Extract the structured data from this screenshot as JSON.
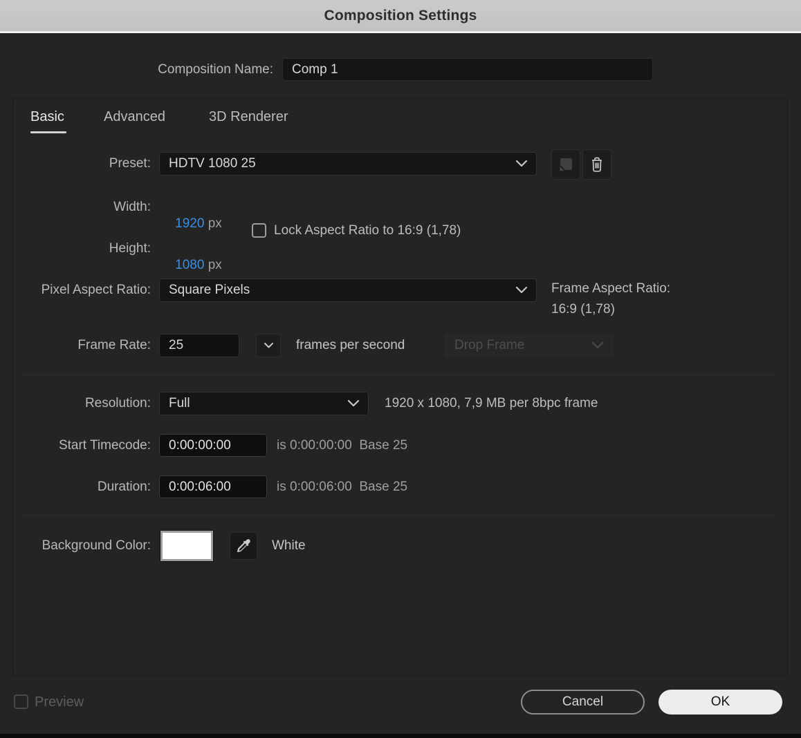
{
  "titlebar": {
    "title": "Composition Settings"
  },
  "composition_name": {
    "label": "Composition Name:",
    "value": "Comp 1"
  },
  "tabs": [
    {
      "label": "Basic",
      "active": true
    },
    {
      "label": "Advanced",
      "active": false
    },
    {
      "label": "3D Renderer",
      "active": false
    }
  ],
  "basic": {
    "preset": {
      "label": "Preset:",
      "value": "HDTV 1080 25"
    },
    "width": {
      "label": "Width:",
      "value": "1920",
      "unit": "px"
    },
    "height": {
      "label": "Height:",
      "value": "1080",
      "unit": "px"
    },
    "lock_aspect": {
      "label": "Lock Aspect Ratio to 16:9 (1,78)",
      "checked": false
    },
    "pixel_aspect_ratio": {
      "label": "Pixel Aspect Ratio:",
      "value": "Square Pixels"
    },
    "frame_aspect_ratio": {
      "label": "Frame Aspect Ratio:",
      "value": "16:9 (1,78)"
    },
    "frame_rate": {
      "label": "Frame Rate:",
      "value": "25",
      "suffix": "frames per second",
      "drop_frame_value": "Drop Frame",
      "drop_frame_enabled": false
    },
    "resolution": {
      "label": "Resolution:",
      "value": "Full",
      "info": "1920 x 1080, 7,9 MB per 8bpc frame"
    },
    "start_timecode": {
      "label": "Start Timecode:",
      "value": "0:00:00:00",
      "suffix": "is 0:00:00:00  Base 25"
    },
    "duration": {
      "label": "Duration:",
      "value": "0:00:06:00",
      "suffix": "is 0:00:06:00  Base 25"
    },
    "background_color": {
      "label": "Background Color:",
      "color_hex": "#ffffff",
      "color_name": "White"
    }
  },
  "footer": {
    "preview_label": "Preview",
    "preview_checked": false,
    "cancel_label": "Cancel",
    "ok_label": "OK"
  },
  "colors": {
    "accent_blue": "#3d8ee0",
    "titlebar_bg": "#c6c6c6",
    "dialog_bg": "#242424",
    "field_bg": "#151515",
    "ok_button_bg": "#ececec"
  }
}
